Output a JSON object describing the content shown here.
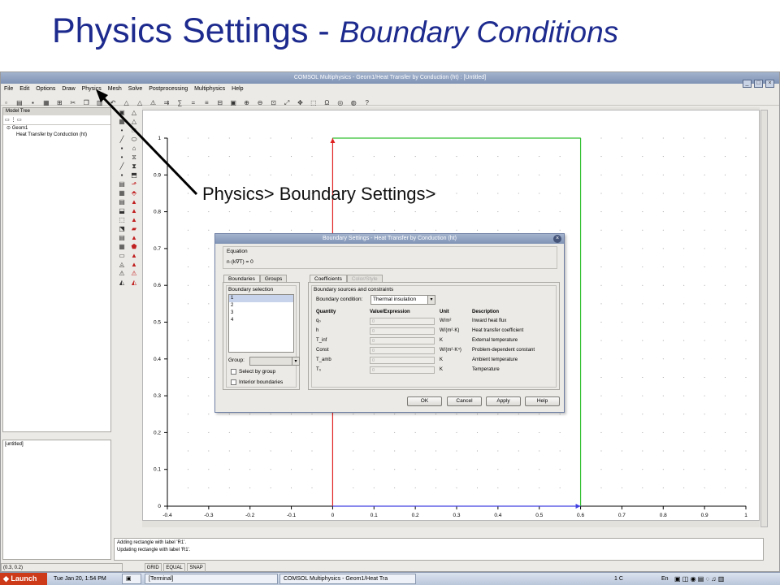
{
  "slide": {
    "title_main": "Physics Settings - ",
    "title_italic": "Boundary Conditions",
    "callout": "Physics> Boundary Settings>"
  },
  "window": {
    "title": "COMSOL Multiphysics - Geom1/Heat Transfer by Conduction (ht) : [Untitled]",
    "menu": [
      "File",
      "Edit",
      "Options",
      "Draw",
      "Physics",
      "Mesh",
      "Solve",
      "Postprocessing",
      "Multiphysics",
      "Help"
    ]
  },
  "model_tree": {
    "title": "Model Tree",
    "nodes": [
      "Geom1",
      "Heat Transfer by Conduction (ht)"
    ],
    "bottom_label": "[untitled]"
  },
  "plot": {
    "x_ticks": [
      "-0.4",
      "-0.3",
      "-0.2",
      "-0.1",
      "0",
      "0.1",
      "0.2",
      "0.3",
      "0.4",
      "0.5",
      "0.6",
      "0.7",
      "0.8",
      "0.9",
      "1"
    ],
    "y_ticks": [
      "1",
      "0.9",
      "0.8",
      "0.7",
      "0.6",
      "0.5",
      "0.4",
      "0.3",
      "0.2",
      "0.1",
      "0"
    ],
    "colors": {
      "left": "#e02020",
      "right": "#30c030",
      "top": "#30c030",
      "bottom": "#4040e0"
    }
  },
  "log": {
    "lines": [
      "Adding rectangle with label 'R1'.",
      "Updating rectangle with label 'R1'."
    ]
  },
  "status": {
    "coords": "(0.3, 0.2)",
    "cells": [
      "GRID",
      "EQUAL",
      "SNAP"
    ]
  },
  "dialog": {
    "title": "Boundary Settings - Heat Transfer by Conduction (ht)",
    "equation_label": "Equation",
    "equation": "n·(k∇T) = 0",
    "left_tabs": [
      "Boundaries",
      "Groups"
    ],
    "boundary_selection_label": "Boundary selection",
    "boundaries": [
      "1",
      "2",
      "3",
      "4"
    ],
    "group_label": "Group:",
    "select_by_group": "Select by group",
    "interior_boundaries": "Interior boundaries",
    "right_tabs": [
      "Coefficients",
      "Color/Style"
    ],
    "sources_label": "Boundary sources and constraints",
    "condition_label": "Boundary condition:",
    "condition_value": "Thermal insulation",
    "headers": [
      "Quantity",
      "Value/Expression",
      "Unit",
      "Description"
    ],
    "rows": [
      {
        "q": "q₀",
        "v": "0",
        "u": "W/m²",
        "d": "Inward heat flux"
      },
      {
        "q": "h",
        "v": "0",
        "u": "W/(m²·K)",
        "d": "Heat transfer coefficient"
      },
      {
        "q": "T_inf",
        "v": "0",
        "u": "K",
        "d": "External temperature"
      },
      {
        "q": "Const",
        "v": "0",
        "u": "W/(m²·K⁴)",
        "d": "Problem-dependent constant"
      },
      {
        "q": "T_amb",
        "v": "0",
        "u": "K",
        "d": "Ambient temperature"
      },
      {
        "q": "T₀",
        "v": "0",
        "u": "K",
        "d": "Temperature"
      }
    ],
    "buttons": [
      "OK",
      "Cancel",
      "Apply",
      "Help"
    ]
  },
  "taskbar": {
    "launch": "Launch",
    "clock": "Tue Jan 20,  1:54 PM",
    "items": [
      "[Terminal]",
      "COMSOL Multiphysics - Geom1/Heat Tra"
    ],
    "workspace": "1 C",
    "lang": "En"
  }
}
